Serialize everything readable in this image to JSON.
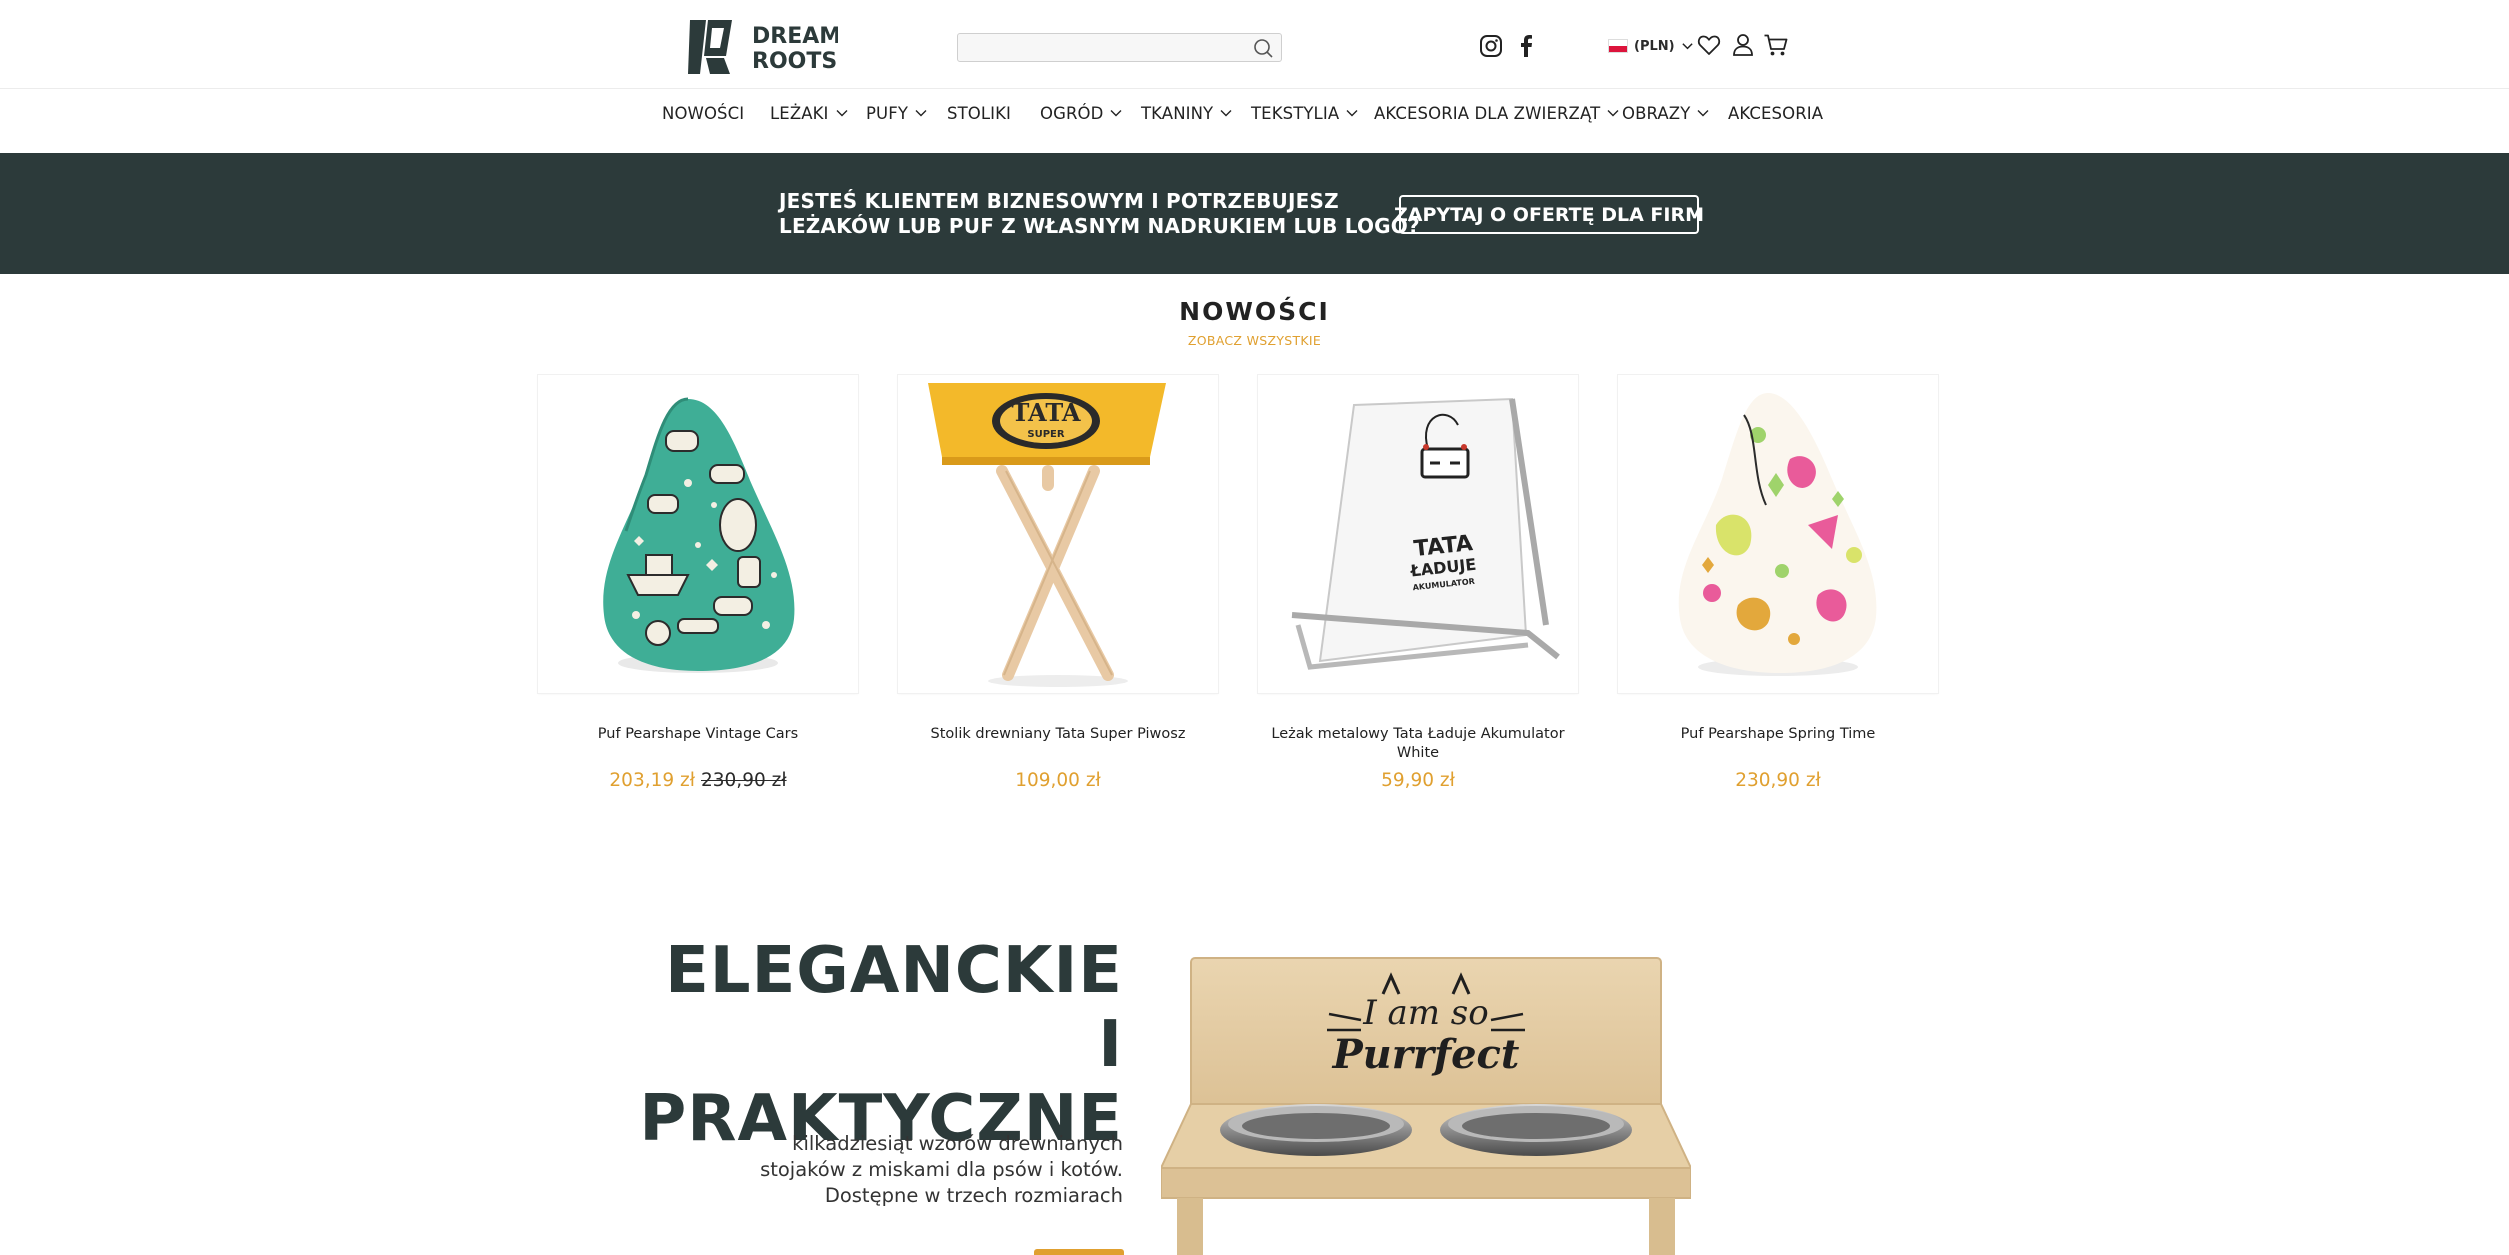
{
  "header": {
    "logo_lines": [
      "DREAM",
      "ROOTS"
    ],
    "search": {
      "placeholder": "",
      "value": ""
    },
    "icons": [
      "search-icon",
      "instagram-icon",
      "facebook-icon",
      "chevron-down-icon",
      "heart-icon",
      "user-icon",
      "cart-icon"
    ],
    "currency_label": "(PLN)"
  },
  "nav": {
    "items": [
      {
        "label": "NOWOŚCI",
        "has_dropdown": false
      },
      {
        "label": "LEŻAKI",
        "has_dropdown": true
      },
      {
        "label": "PUFY",
        "has_dropdown": true
      },
      {
        "label": "STOLIKI",
        "has_dropdown": false
      },
      {
        "label": "OGRÓD",
        "has_dropdown": true
      },
      {
        "label": "TKANINY",
        "has_dropdown": true
      },
      {
        "label": "TEKSTYLIA",
        "has_dropdown": true
      },
      {
        "label": "AKCESORIA DLA ZWIERZĄT",
        "has_dropdown": true
      },
      {
        "label": "OBRAZY",
        "has_dropdown": true
      },
      {
        "label": "AKCESORIA",
        "has_dropdown": false
      }
    ]
  },
  "banner": {
    "line1": "JESTEŚ KLIENTEM BIZNESOWYM I POTRZEBUJESZ",
    "line2": "LEŻAKÓW LUB PUF Z WŁASNYM NADRUKIEM LUB LOGO?",
    "cta": "ZAPYTAJ O OFERTĘ DLA FIRM"
  },
  "new_section": {
    "title": "NOWOŚCI",
    "see_all": "ZOBACZ WSZYSTKIE",
    "products": [
      {
        "name": "Puf Pearshape Vintage Cars",
        "price": "203,19 zł",
        "old_price": "230,90 zł"
      },
      {
        "name": "Stolik drewniany Tata Super Piwosz",
        "price": "109,00 zł",
        "old_price": ""
      },
      {
        "name": "Leżak metalowy Tata Ładuje Akumulator White",
        "price": "59,90 zł",
        "old_price": ""
      },
      {
        "name": "Puf Pearshape Spring Time",
        "price": "230,90 zł",
        "old_price": ""
      }
    ],
    "product_image_texts": [
      "TATA",
      "SUPER",
      "TATA",
      "ŁADUJE",
      "AKUMULATOR"
    ]
  },
  "hero": {
    "title_line1": "ELEGANCKIE I",
    "title_line2": "PRAKTYCZNE",
    "desc_line1": "kilkadziesiąt wzorów drewnianych",
    "desc_line2": "stojaków z miskami dla psów i kotów.",
    "desc_line3": "Dostępne w trzech rozmiarach",
    "image_text_line1": "I am so",
    "image_text_line2": "Purrfect"
  },
  "colors": {
    "accent": "#e0a030",
    "banner_bg": "#2c3a3a",
    "text_dark": "#222222",
    "teal_pattern": "#3fae96"
  }
}
